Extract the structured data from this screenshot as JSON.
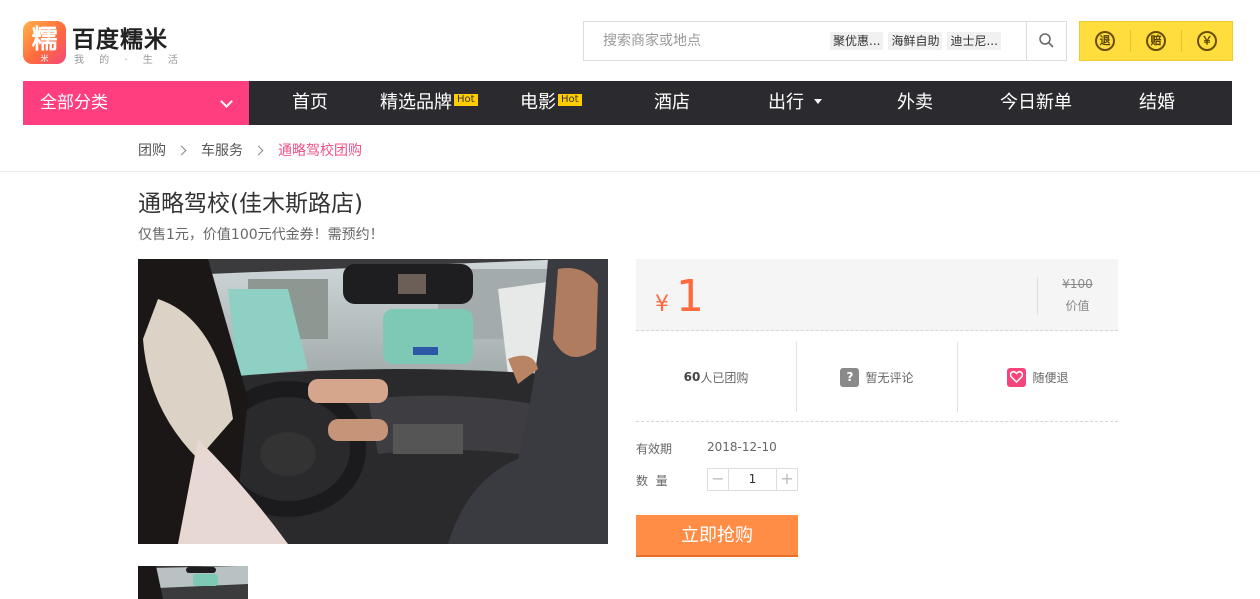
{
  "header": {
    "logo_char": "糯",
    "logo_char_sub": "米",
    "logo_title": "百度糯米",
    "logo_slogan": "我 的 · 生 活",
    "search_placeholder": "搜索商家或地点",
    "hot_tags": [
      "聚优惠...",
      "海鲜自助",
      "迪士尼..."
    ],
    "search_icon": "search-icon",
    "guarantees": [
      "退",
      "赔",
      "￥"
    ]
  },
  "nav": {
    "all_categories": "全部分类",
    "items": [
      "首页",
      "精选品牌",
      "电影",
      "酒店",
      "出行",
      "外卖",
      "今日新单",
      "结婚"
    ],
    "hot_label": "Hot",
    "accent_color": "#ff3e80"
  },
  "breadcrumb": [
    "团购",
    "车服务",
    "通略驾校团购"
  ],
  "deal": {
    "title": "通略驾校(佳木斯路店)",
    "subtitle": "仅售1元，价值100元代金券！需预约！",
    "currency": "¥",
    "price": "1",
    "original_price": "¥100",
    "original_label": "价值",
    "sold_count": "60",
    "sold_suffix": "人已团购",
    "review_text": "暂无评论",
    "refund_text": "随便退",
    "validity_label": "有效期",
    "validity_value": "2018-12-10",
    "quantity_label": "数  量",
    "quantity": "1",
    "buy_label": "立即抢购",
    "price_color": "#ff6a3d"
  }
}
